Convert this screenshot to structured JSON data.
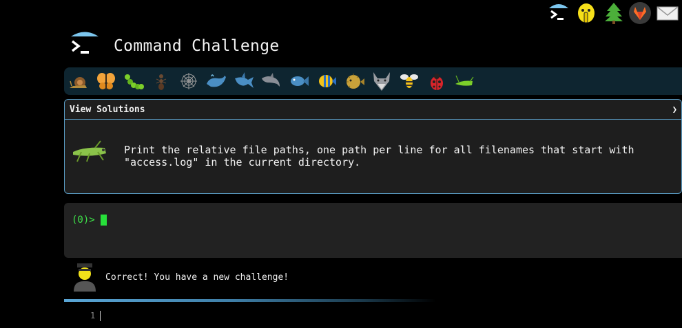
{
  "header": {
    "title": "Command Challenge"
  },
  "top_icons": [
    "terminal-umbrella-icon",
    "shushing-face-icon",
    "tree-icon",
    "gitlab-icon",
    "mail-icon"
  ],
  "levels": [
    "snail",
    "butterfly",
    "caterpillar",
    "ant",
    "spider-web",
    "whale",
    "shark",
    "dolphin",
    "fish",
    "tropical-fish",
    "blowfish",
    "wolf",
    "bee",
    "ladybug",
    "cricket"
  ],
  "panel": {
    "title": "View Solutions",
    "chevron": "❯",
    "description": "Print the relative file paths, one path per line for all filenames that start with \"access.log\" in the current directory."
  },
  "terminal": {
    "prompt": "(0)>"
  },
  "feedback": {
    "message": "Correct! You have a new challenge!"
  },
  "progress": 0.6,
  "editor": {
    "line_number": "1"
  },
  "colors": {
    "accent": "#5a9cc4",
    "prompt_green": "#3ee64a",
    "level_bar": "#0e2530"
  }
}
